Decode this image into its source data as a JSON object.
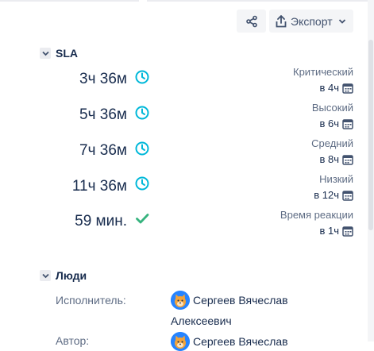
{
  "toolbar": {
    "share_icon": "share-icon",
    "export_label": "Экспорт",
    "export_icon": "upload-icon"
  },
  "sla": {
    "section_title": "SLA",
    "items": [
      {
        "time": "3ч 36м",
        "status": "clock",
        "name": "Критический",
        "goal": "в 4ч"
      },
      {
        "time": "5ч 36м",
        "status": "clock",
        "name": "Высокий",
        "goal": "в 6ч"
      },
      {
        "time": "7ч 36м",
        "status": "clock",
        "name": "Средний",
        "goal": "в 8ч"
      },
      {
        "time": "11ч 36м",
        "status": "clock",
        "name": "Низкий",
        "goal": "в 12ч"
      },
      {
        "time": "59 мин.",
        "status": "check",
        "name": "Время реакции",
        "goal": "в 1ч"
      }
    ]
  },
  "people": {
    "section_title": "Люди",
    "assignee_label": "Исполнитель:",
    "assignee_name_line1": "Сергеев Вячеслав",
    "assignee_name_line2": "Алексеевич",
    "reporter_label": "Автор:",
    "reporter_name": "Сергеев Вячеслав"
  },
  "colors": {
    "clock": "#00b8d9",
    "check": "#36b37e",
    "button_bg": "#f4f5f7"
  }
}
